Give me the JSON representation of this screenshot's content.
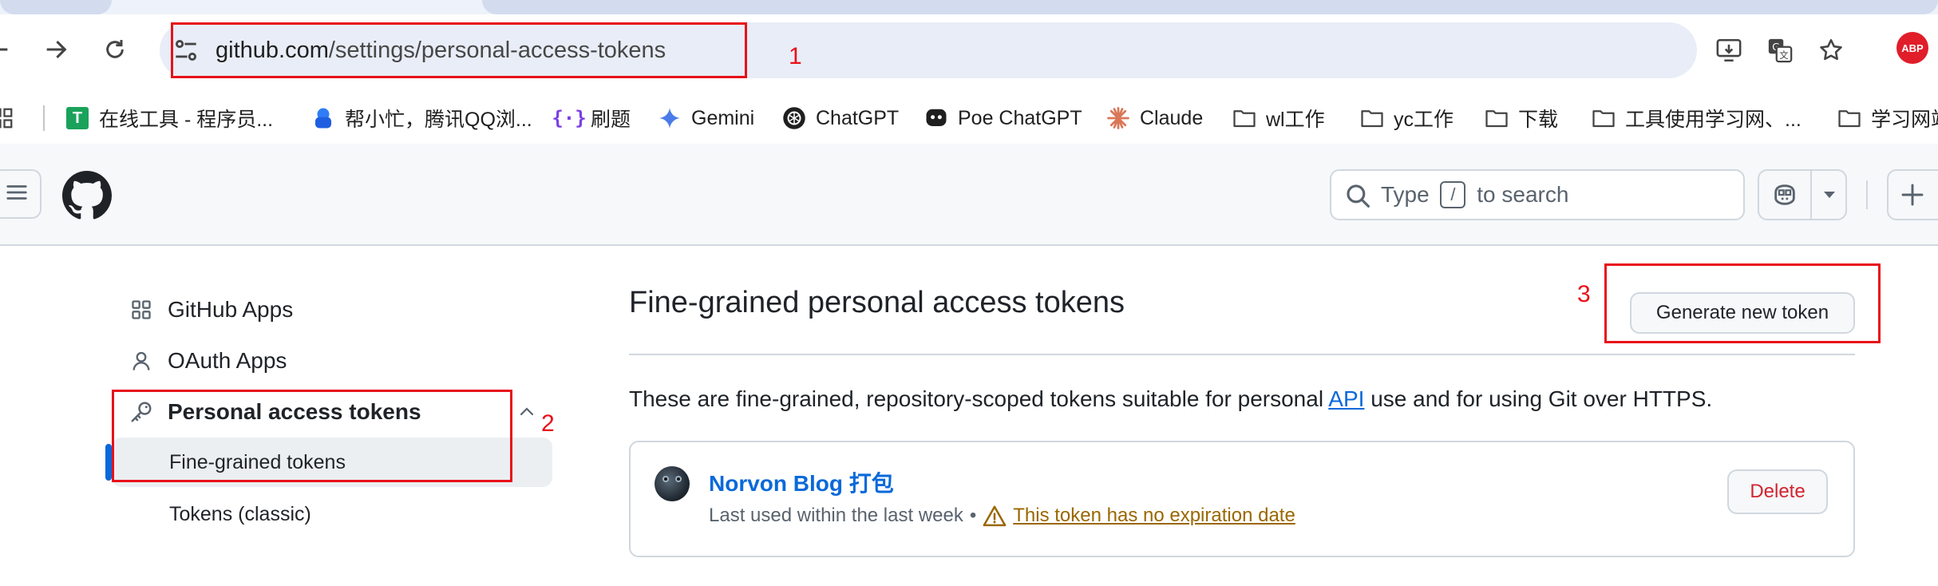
{
  "browser": {
    "url_host": "github.com",
    "url_path": "/settings/personal-access-tokens",
    "bookmarks": [
      {
        "label": "在线工具 - 程序员...",
        "icon": "tool-site-icon"
      },
      {
        "label": "帮小忙，腾讯QQ浏...",
        "icon": "qq-helper-icon"
      },
      {
        "label": "刷题",
        "icon": "code-practice-icon"
      },
      {
        "label": "Gemini",
        "icon": "gemini-icon"
      },
      {
        "label": "ChatGPT",
        "icon": "chatgpt-icon"
      },
      {
        "label": "Poe ChatGPT",
        "icon": "poe-icon"
      },
      {
        "label": "Claude",
        "icon": "claude-icon"
      },
      {
        "label": "wl工作",
        "icon": "folder-icon"
      },
      {
        "label": "yc工作",
        "icon": "folder-icon"
      },
      {
        "label": "下载",
        "icon": "folder-icon"
      },
      {
        "label": "工具使用学习网、...",
        "icon": "folder-icon"
      },
      {
        "label": "学习网站",
        "icon": "folder-icon"
      }
    ]
  },
  "github": {
    "search": {
      "prefix": "Type",
      "key": "/",
      "suffix": "to search"
    }
  },
  "sidebar": {
    "items": [
      {
        "label": "GitHub Apps"
      },
      {
        "label": "OAuth Apps"
      },
      {
        "label": "Personal access tokens"
      }
    ],
    "sub_items": [
      {
        "label": "Fine-grained tokens"
      },
      {
        "label": "Tokens (classic)"
      }
    ]
  },
  "main": {
    "title": "Fine-grained personal access tokens",
    "generate_button": "Generate new token",
    "description_before": "These are fine-grained, repository-scoped tokens suitable for personal ",
    "description_link": "API",
    "description_after": " use and for using Git over HTTPS.",
    "token": {
      "name": "Norvon Blog 打包",
      "last_used": "Last used within the last week",
      "separator": "•",
      "warning": "This token has no expiration date",
      "delete_label": "Delete"
    }
  },
  "annotations": [
    "1",
    "2",
    "3"
  ],
  "colors": {
    "annotation": "#e8111a",
    "link": "#0969da",
    "danger": "#d1242f",
    "warning": "#9a6700",
    "selected_bar": "#0969da"
  }
}
